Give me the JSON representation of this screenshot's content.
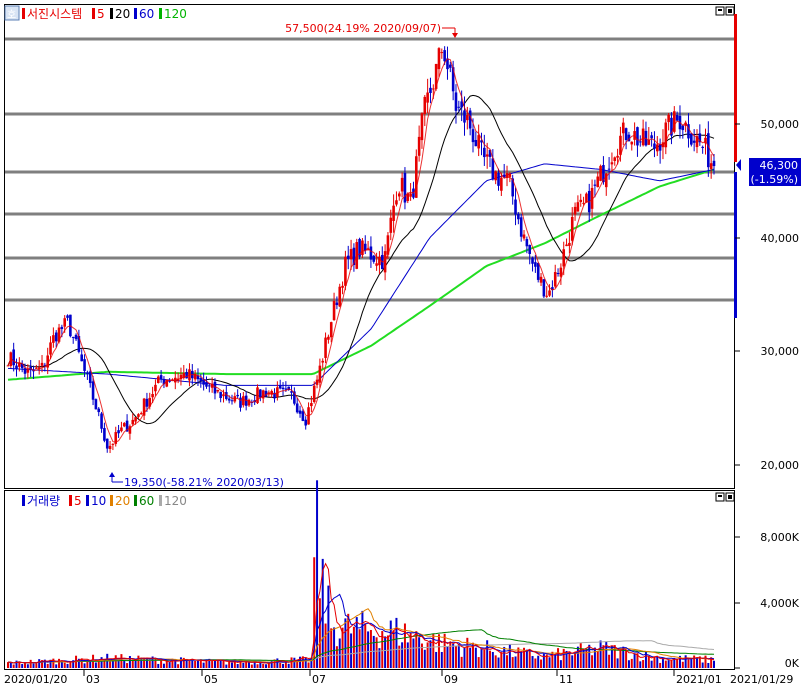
{
  "price_panel": {
    "legend": {
      "stock_name": "서진시스템",
      "ma_labels": [
        "5",
        "20",
        "60",
        "120"
      ],
      "ma_colors": [
        "#e60000",
        "#000000",
        "#0000cc",
        "#00b400"
      ]
    },
    "corner_button": "호",
    "high_label": "57,500(24.19% 2020/09/07)",
    "low_label": "19,350(-58.21% 2020/03/13)",
    "current_price": "46,300",
    "current_change": "(-1.59%)",
    "y_ticks": [
      "50,000",
      "40,000",
      "30,000",
      "20,000"
    ]
  },
  "volume_panel": {
    "legend": {
      "title": "거래량",
      "ma_labels": [
        "5",
        "10",
        "20",
        "60",
        "120"
      ],
      "ma_colors": [
        "#e60000",
        "#0000cc",
        "#e08000",
        "#008000",
        "#aaaaaa"
      ]
    },
    "y_ticks": [
      "8,000K",
      "4,000K",
      "0K"
    ]
  },
  "x_axis": {
    "labels": [
      "2020/01/20",
      "03",
      "05",
      "07",
      "09",
      "11",
      "2021/01",
      "2021/01/29"
    ]
  },
  "chart_data": {
    "type": "candlestick",
    "title": "서진시스템",
    "date_range": [
      "2020/01/20",
      "2021/01/29"
    ],
    "y_ticks": [
      20000,
      30000,
      40000,
      50000
    ],
    "price_path": [
      [
        "2020/01/20",
        29500
      ],
      [
        "2020/01/31",
        28000
      ],
      [
        "2020/02/07",
        28500
      ],
      [
        "2020/02/14",
        31500
      ],
      [
        "2020/02/21",
        32500
      ],
      [
        "2020/02/28",
        29000
      ],
      [
        "2020/03/06",
        25500
      ],
      [
        "2020/03/13",
        21500
      ],
      [
        "2020/03/20",
        23000
      ],
      [
        "2020/03/27",
        24000
      ],
      [
        "2020/04/10",
        27500
      ],
      [
        "2020/04/24",
        28000
      ],
      [
        "2020/05/08",
        26500
      ],
      [
        "2020/05/22",
        25500
      ],
      [
        "2020/06/05",
        26500
      ],
      [
        "2020/06/19",
        26000
      ],
      [
        "2020/06/26",
        24000
      ],
      [
        "2020/07/03",
        28000
      ],
      [
        "2020/07/10",
        33000
      ],
      [
        "2020/07/17",
        37500
      ],
      [
        "2020/07/24",
        39000
      ],
      [
        "2020/07/31",
        38500
      ],
      [
        "2020/08/07",
        38000
      ],
      [
        "2020/08/14",
        45000
      ],
      [
        "2020/08/21",
        43000
      ],
      [
        "2020/08/28",
        51000
      ],
      [
        "2020/09/04",
        55000
      ],
      [
        "2020/09/07",
        57000
      ],
      [
        "2020/09/14",
        51500
      ],
      [
        "2020/09/21",
        50000
      ],
      [
        "2020/09/28",
        47000
      ],
      [
        "2020/10/05",
        45500
      ],
      [
        "2020/10/12",
        45000
      ],
      [
        "2020/10/19",
        40500
      ],
      [
        "2020/10/26",
        37000
      ],
      [
        "2020/11/02",
        35000
      ],
      [
        "2020/11/09",
        38000
      ],
      [
        "2020/11/16",
        42000
      ],
      [
        "2020/11/23",
        43000
      ],
      [
        "2020/11/30",
        45500
      ],
      [
        "2020/12/07",
        48000
      ],
      [
        "2020/12/14",
        49500
      ],
      [
        "2020/12/21",
        48500
      ],
      [
        "2020/12/28",
        48000
      ],
      [
        "2021/01/04",
        49500
      ],
      [
        "2021/01/11",
        50500
      ],
      [
        "2021/01/18",
        49000
      ],
      [
        "2021/01/25",
        47500
      ],
      [
        "2021/01/29",
        46300
      ]
    ],
    "high": {
      "date": "2020/09/07",
      "price": 57500,
      "change_pct": 24.19
    },
    "low": {
      "date": "2020/03/13",
      "price": 19350,
      "change_pct": -58.21
    },
    "last": {
      "price": 46300,
      "change_pct": -1.59
    },
    "ma120_path": [
      [
        "2020/01/20",
        27500
      ],
      [
        "2020/03/13",
        28200
      ],
      [
        "2020/05/15",
        28000
      ],
      [
        "2020/06/30",
        28000
      ],
      [
        "2020/07/31",
        30500
      ],
      [
        "2020/08/31",
        34000
      ],
      [
        "2020/09/30",
        37500
      ],
      [
        "2020/10/31",
        39500
      ],
      [
        "2020/11/30",
        42000
      ],
      [
        "2020/12/31",
        44500
      ],
      [
        "2021/01/29",
        46000
      ]
    ],
    "ma60_path": [
      [
        "2020/01/20",
        28500
      ],
      [
        "2020/03/13",
        28000
      ],
      [
        "2020/05/15",
        27000
      ],
      [
        "2020/06/30",
        27000
      ],
      [
        "2020/07/31",
        32000
      ],
      [
        "2020/08/31",
        40000
      ],
      [
        "2020/09/30",
        45000
      ],
      [
        "2020/10/31",
        46500
      ],
      [
        "2020/11/30",
        46000
      ],
      [
        "2020/12/31",
        45000
      ],
      [
        "2021/01/29",
        46000
      ]
    ],
    "volume_k_path": [
      [
        "2020/01/20",
        300
      ],
      [
        "2020/03/13",
        600
      ],
      [
        "2020/05/15",
        350
      ],
      [
        "2020/06/30",
        500
      ],
      [
        "2020/07/01",
        10000
      ],
      [
        "2020/07/03",
        6000
      ],
      [
        "2020/07/10",
        2500
      ],
      [
        "2020/08/14",
        2200
      ],
      [
        "2020/09/07",
        1500
      ],
      [
        "2020/10/31",
        700
      ],
      [
        "2020/11/30",
        1200
      ],
      [
        "2020/12/31",
        600
      ],
      [
        "2021/01/29",
        500
      ]
    ],
    "volume_y_ticks": [
      0,
      4000,
      8000
    ]
  }
}
